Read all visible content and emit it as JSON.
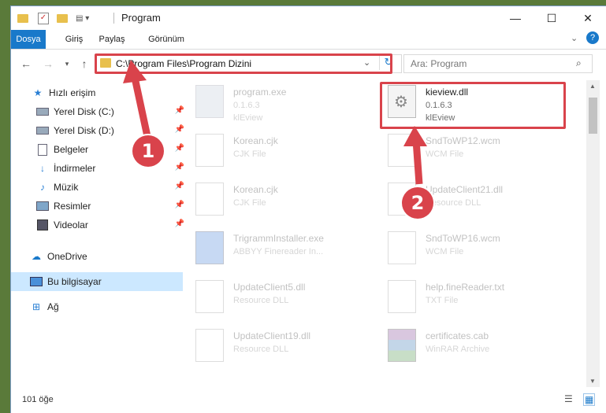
{
  "window": {
    "title": "Program"
  },
  "ribbon": {
    "tabs": [
      "Dosya",
      "Giriş",
      "Paylaş",
      "Görünüm"
    ]
  },
  "address": {
    "path": "C:\\Program Files\\Program Dizini"
  },
  "search": {
    "placeholder": "Ara: Program"
  },
  "sidebar": {
    "items": [
      {
        "label": "Hızlı erişim",
        "icon": "star-icon"
      },
      {
        "label": "Yerel Disk (C:)",
        "icon": "drive-icon"
      },
      {
        "label": "Yerel Disk (D:)",
        "icon": "drive-icon"
      },
      {
        "label": "Belgeler",
        "icon": "documents-icon"
      },
      {
        "label": "İndirmeler",
        "icon": "download-icon"
      },
      {
        "label": "Müzik",
        "icon": "music-icon"
      },
      {
        "label": "Resimler",
        "icon": "pictures-icon"
      },
      {
        "label": "Videolar",
        "icon": "videos-icon"
      },
      {
        "label": "OneDrive",
        "icon": "cloud-icon"
      },
      {
        "label": "Bu bilgisayar",
        "icon": "computer-icon"
      },
      {
        "label": "Ağ",
        "icon": "network-icon"
      }
    ]
  },
  "files": [
    {
      "name": "program.exe",
      "line2": "0.1.6.3",
      "line3": "klEview"
    },
    {
      "name": "kieview.dll",
      "line2": "0.1.6.3",
      "line3": "klEview"
    },
    {
      "name": "Korean.cjk",
      "line2": "CJK File",
      "line3": ""
    },
    {
      "name": "SndToWP12.wcm",
      "line2": "WCM File",
      "line3": ""
    },
    {
      "name": "Korean.cjk",
      "line2": "CJK File",
      "line3": ""
    },
    {
      "name": "UpdateClient21.dll",
      "line2": "Resource DLL",
      "line3": ""
    },
    {
      "name": "TrigrammInstaller.exe",
      "line2": "ABBYY Finereader In...",
      "line3": ""
    },
    {
      "name": "SndToWP16.wcm",
      "line2": "WCM File",
      "line3": ""
    },
    {
      "name": "UpdateClient5.dll",
      "line2": "Resource DLL",
      "line3": ""
    },
    {
      "name": "help.fineReader.txt",
      "line2": "TXT File",
      "line3": ""
    },
    {
      "name": "UpdateClient19.dll",
      "line2": "Resource DLL",
      "line3": ""
    },
    {
      "name": "certificates.cab",
      "line2": "WinRAR Archive",
      "line3": ""
    }
  ],
  "status": {
    "count": "101 öğe"
  },
  "callouts": [
    "1",
    "2"
  ]
}
